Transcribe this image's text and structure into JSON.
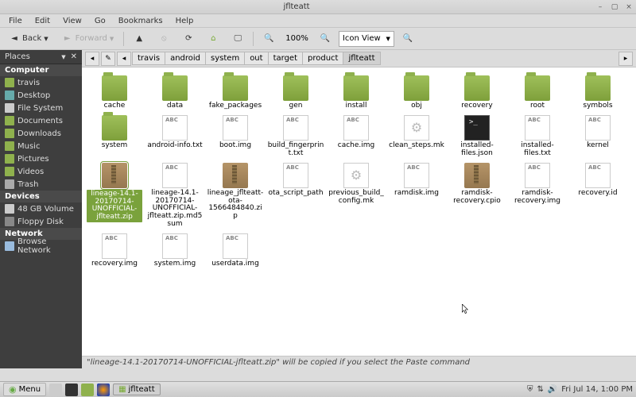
{
  "window": {
    "title": "jflteatt",
    "min": "–",
    "max": "▢",
    "close": "×"
  },
  "menubar": [
    "File",
    "Edit",
    "View",
    "Go",
    "Bookmarks",
    "Help"
  ],
  "toolbar": {
    "back": "Back",
    "forward": "Forward",
    "zoom": "100%",
    "view_mode": "Icon View"
  },
  "sidebar": {
    "header": "Places",
    "groups": [
      {
        "label": "Computer",
        "items": [
          {
            "icon": "home",
            "label": "travis"
          },
          {
            "icon": "desktop",
            "label": "Desktop"
          },
          {
            "icon": "fs",
            "label": "File System"
          },
          {
            "icon": "folder",
            "label": "Documents"
          },
          {
            "icon": "folder",
            "label": "Downloads"
          },
          {
            "icon": "folder",
            "label": "Music"
          },
          {
            "icon": "folder",
            "label": "Pictures"
          },
          {
            "icon": "folder",
            "label": "Videos"
          },
          {
            "icon": "trash",
            "label": "Trash"
          }
        ]
      },
      {
        "label": "Devices",
        "items": [
          {
            "icon": "drive",
            "label": "48 GB Volume"
          },
          {
            "icon": "floppy",
            "label": "Floppy Disk"
          }
        ]
      },
      {
        "label": "Network",
        "items": [
          {
            "icon": "network",
            "label": "Browse Network"
          }
        ]
      }
    ]
  },
  "breadcrumbs": [
    "travis",
    "android",
    "system",
    "out",
    "target",
    "product",
    "jflteatt"
  ],
  "files": [
    {
      "name": "cache",
      "kind": "folder"
    },
    {
      "name": "data",
      "kind": "folder"
    },
    {
      "name": "fake_packages",
      "kind": "folder"
    },
    {
      "name": "gen",
      "kind": "folder"
    },
    {
      "name": "install",
      "kind": "folder"
    },
    {
      "name": "obj",
      "kind": "folder"
    },
    {
      "name": "recovery",
      "kind": "folder"
    },
    {
      "name": "root",
      "kind": "folder"
    },
    {
      "name": "symbols",
      "kind": "folder"
    },
    {
      "name": "system",
      "kind": "folder"
    },
    {
      "name": "android-info.txt",
      "kind": "text"
    },
    {
      "name": "boot.img",
      "kind": "bin"
    },
    {
      "name": "build_fingerprint.txt",
      "kind": "text"
    },
    {
      "name": "cache.img",
      "kind": "bin"
    },
    {
      "name": "clean_steps.mk",
      "kind": "gear"
    },
    {
      "name": "installed-files.json",
      "kind": "term"
    },
    {
      "name": "installed-files.txt",
      "kind": "text"
    },
    {
      "name": "kernel",
      "kind": "bin"
    },
    {
      "name": "lineage-14.1-20170714-UNOFFICIAL-jflteatt.zip",
      "kind": "zip",
      "selected": true
    },
    {
      "name": "lineage-14.1-20170714-UNOFFICIAL-jflteatt.zip.md5sum",
      "kind": "text"
    },
    {
      "name": "lineage_jflteatt-ota-1566484840.zip",
      "kind": "zip"
    },
    {
      "name": "ota_script_path",
      "kind": "text"
    },
    {
      "name": "previous_build_config.mk",
      "kind": "gear"
    },
    {
      "name": "ramdisk.img",
      "kind": "bin"
    },
    {
      "name": "ramdisk-recovery.cpio",
      "kind": "zip"
    },
    {
      "name": "ramdisk-recovery.img",
      "kind": "bin"
    },
    {
      "name": "recovery.id",
      "kind": "bin"
    },
    {
      "name": "recovery.img",
      "kind": "bin"
    },
    {
      "name": "system.img",
      "kind": "bin"
    },
    {
      "name": "userdata.img",
      "kind": "bin"
    }
  ],
  "status": "\"lineage-14.1-20170714-UNOFFICIAL-jflteatt.zip\" will be copied if you select the Paste command",
  "taskbar": {
    "menu": "Menu",
    "task": "jflteatt",
    "clock": "Fri Jul 14,  1:00 PM"
  }
}
